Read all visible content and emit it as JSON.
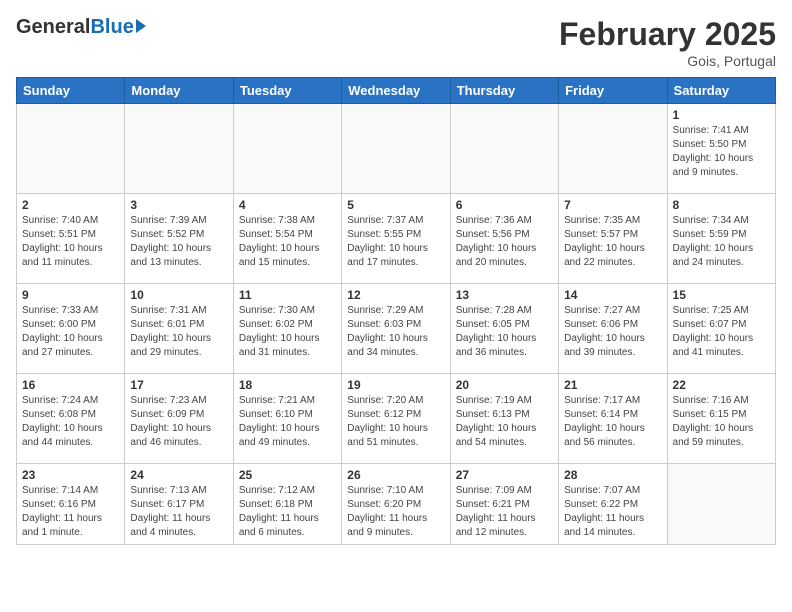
{
  "header": {
    "logo_general": "General",
    "logo_blue": "Blue",
    "month_title": "February 2025",
    "subtitle": "Gois, Portugal"
  },
  "days_of_week": [
    "Sunday",
    "Monday",
    "Tuesday",
    "Wednesday",
    "Thursday",
    "Friday",
    "Saturday"
  ],
  "weeks": [
    [
      {
        "day": "",
        "info": ""
      },
      {
        "day": "",
        "info": ""
      },
      {
        "day": "",
        "info": ""
      },
      {
        "day": "",
        "info": ""
      },
      {
        "day": "",
        "info": ""
      },
      {
        "day": "",
        "info": ""
      },
      {
        "day": "1",
        "info": "Sunrise: 7:41 AM\nSunset: 5:50 PM\nDaylight: 10 hours\nand 9 minutes."
      }
    ],
    [
      {
        "day": "2",
        "info": "Sunrise: 7:40 AM\nSunset: 5:51 PM\nDaylight: 10 hours\nand 11 minutes."
      },
      {
        "day": "3",
        "info": "Sunrise: 7:39 AM\nSunset: 5:52 PM\nDaylight: 10 hours\nand 13 minutes."
      },
      {
        "day": "4",
        "info": "Sunrise: 7:38 AM\nSunset: 5:54 PM\nDaylight: 10 hours\nand 15 minutes."
      },
      {
        "day": "5",
        "info": "Sunrise: 7:37 AM\nSunset: 5:55 PM\nDaylight: 10 hours\nand 17 minutes."
      },
      {
        "day": "6",
        "info": "Sunrise: 7:36 AM\nSunset: 5:56 PM\nDaylight: 10 hours\nand 20 minutes."
      },
      {
        "day": "7",
        "info": "Sunrise: 7:35 AM\nSunset: 5:57 PM\nDaylight: 10 hours\nand 22 minutes."
      },
      {
        "day": "8",
        "info": "Sunrise: 7:34 AM\nSunset: 5:59 PM\nDaylight: 10 hours\nand 24 minutes."
      }
    ],
    [
      {
        "day": "9",
        "info": "Sunrise: 7:33 AM\nSunset: 6:00 PM\nDaylight: 10 hours\nand 27 minutes."
      },
      {
        "day": "10",
        "info": "Sunrise: 7:31 AM\nSunset: 6:01 PM\nDaylight: 10 hours\nand 29 minutes."
      },
      {
        "day": "11",
        "info": "Sunrise: 7:30 AM\nSunset: 6:02 PM\nDaylight: 10 hours\nand 31 minutes."
      },
      {
        "day": "12",
        "info": "Sunrise: 7:29 AM\nSunset: 6:03 PM\nDaylight: 10 hours\nand 34 minutes."
      },
      {
        "day": "13",
        "info": "Sunrise: 7:28 AM\nSunset: 6:05 PM\nDaylight: 10 hours\nand 36 minutes."
      },
      {
        "day": "14",
        "info": "Sunrise: 7:27 AM\nSunset: 6:06 PM\nDaylight: 10 hours\nand 39 minutes."
      },
      {
        "day": "15",
        "info": "Sunrise: 7:25 AM\nSunset: 6:07 PM\nDaylight: 10 hours\nand 41 minutes."
      }
    ],
    [
      {
        "day": "16",
        "info": "Sunrise: 7:24 AM\nSunset: 6:08 PM\nDaylight: 10 hours\nand 44 minutes."
      },
      {
        "day": "17",
        "info": "Sunrise: 7:23 AM\nSunset: 6:09 PM\nDaylight: 10 hours\nand 46 minutes."
      },
      {
        "day": "18",
        "info": "Sunrise: 7:21 AM\nSunset: 6:10 PM\nDaylight: 10 hours\nand 49 minutes."
      },
      {
        "day": "19",
        "info": "Sunrise: 7:20 AM\nSunset: 6:12 PM\nDaylight: 10 hours\nand 51 minutes."
      },
      {
        "day": "20",
        "info": "Sunrise: 7:19 AM\nSunset: 6:13 PM\nDaylight: 10 hours\nand 54 minutes."
      },
      {
        "day": "21",
        "info": "Sunrise: 7:17 AM\nSunset: 6:14 PM\nDaylight: 10 hours\nand 56 minutes."
      },
      {
        "day": "22",
        "info": "Sunrise: 7:16 AM\nSunset: 6:15 PM\nDaylight: 10 hours\nand 59 minutes."
      }
    ],
    [
      {
        "day": "23",
        "info": "Sunrise: 7:14 AM\nSunset: 6:16 PM\nDaylight: 11 hours\nand 1 minute."
      },
      {
        "day": "24",
        "info": "Sunrise: 7:13 AM\nSunset: 6:17 PM\nDaylight: 11 hours\nand 4 minutes."
      },
      {
        "day": "25",
        "info": "Sunrise: 7:12 AM\nSunset: 6:18 PM\nDaylight: 11 hours\nand 6 minutes."
      },
      {
        "day": "26",
        "info": "Sunrise: 7:10 AM\nSunset: 6:20 PM\nDaylight: 11 hours\nand 9 minutes."
      },
      {
        "day": "27",
        "info": "Sunrise: 7:09 AM\nSunset: 6:21 PM\nDaylight: 11 hours\nand 12 minutes."
      },
      {
        "day": "28",
        "info": "Sunrise: 7:07 AM\nSunset: 6:22 PM\nDaylight: 11 hours\nand 14 minutes."
      },
      {
        "day": "",
        "info": ""
      }
    ]
  ]
}
